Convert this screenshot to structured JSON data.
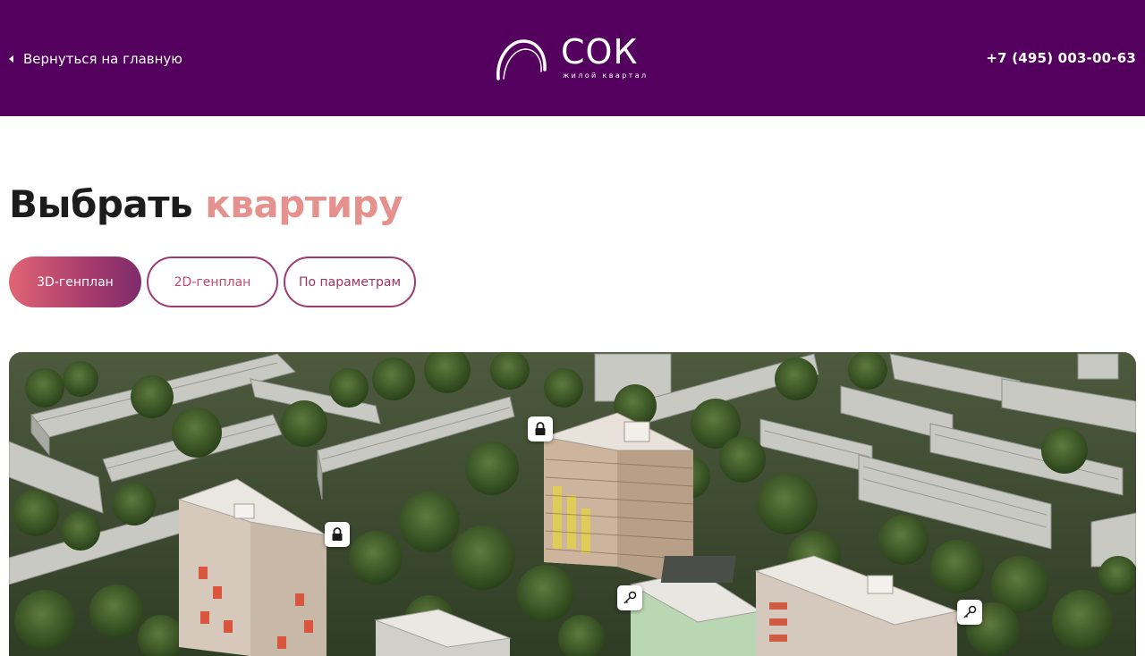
{
  "header": {
    "back_label": "Вернуться на главную",
    "logo_name": "СОК",
    "logo_subtitle": "жилой квартал",
    "phone": "+7 (495) 003-00-63"
  },
  "title": {
    "main": "Выбрать",
    "accent": "квартиру"
  },
  "tabs": [
    {
      "label": "3D-генплан",
      "active": true
    },
    {
      "label": "2D-генплан",
      "active": false
    },
    {
      "label": "По параметрам",
      "active": false
    }
  ],
  "scene": {
    "markers": [
      {
        "icon": "lock-icon"
      },
      {
        "icon": "lock-icon"
      },
      {
        "icon": "key-icon"
      },
      {
        "icon": "key-icon"
      }
    ]
  },
  "colors": {
    "header_bg": "#54005e",
    "title_accent": "#e5928f",
    "tab_gradient_start": "#e06575",
    "tab_gradient_end": "#7e2b6c",
    "tab_border": "#9d3b72"
  }
}
